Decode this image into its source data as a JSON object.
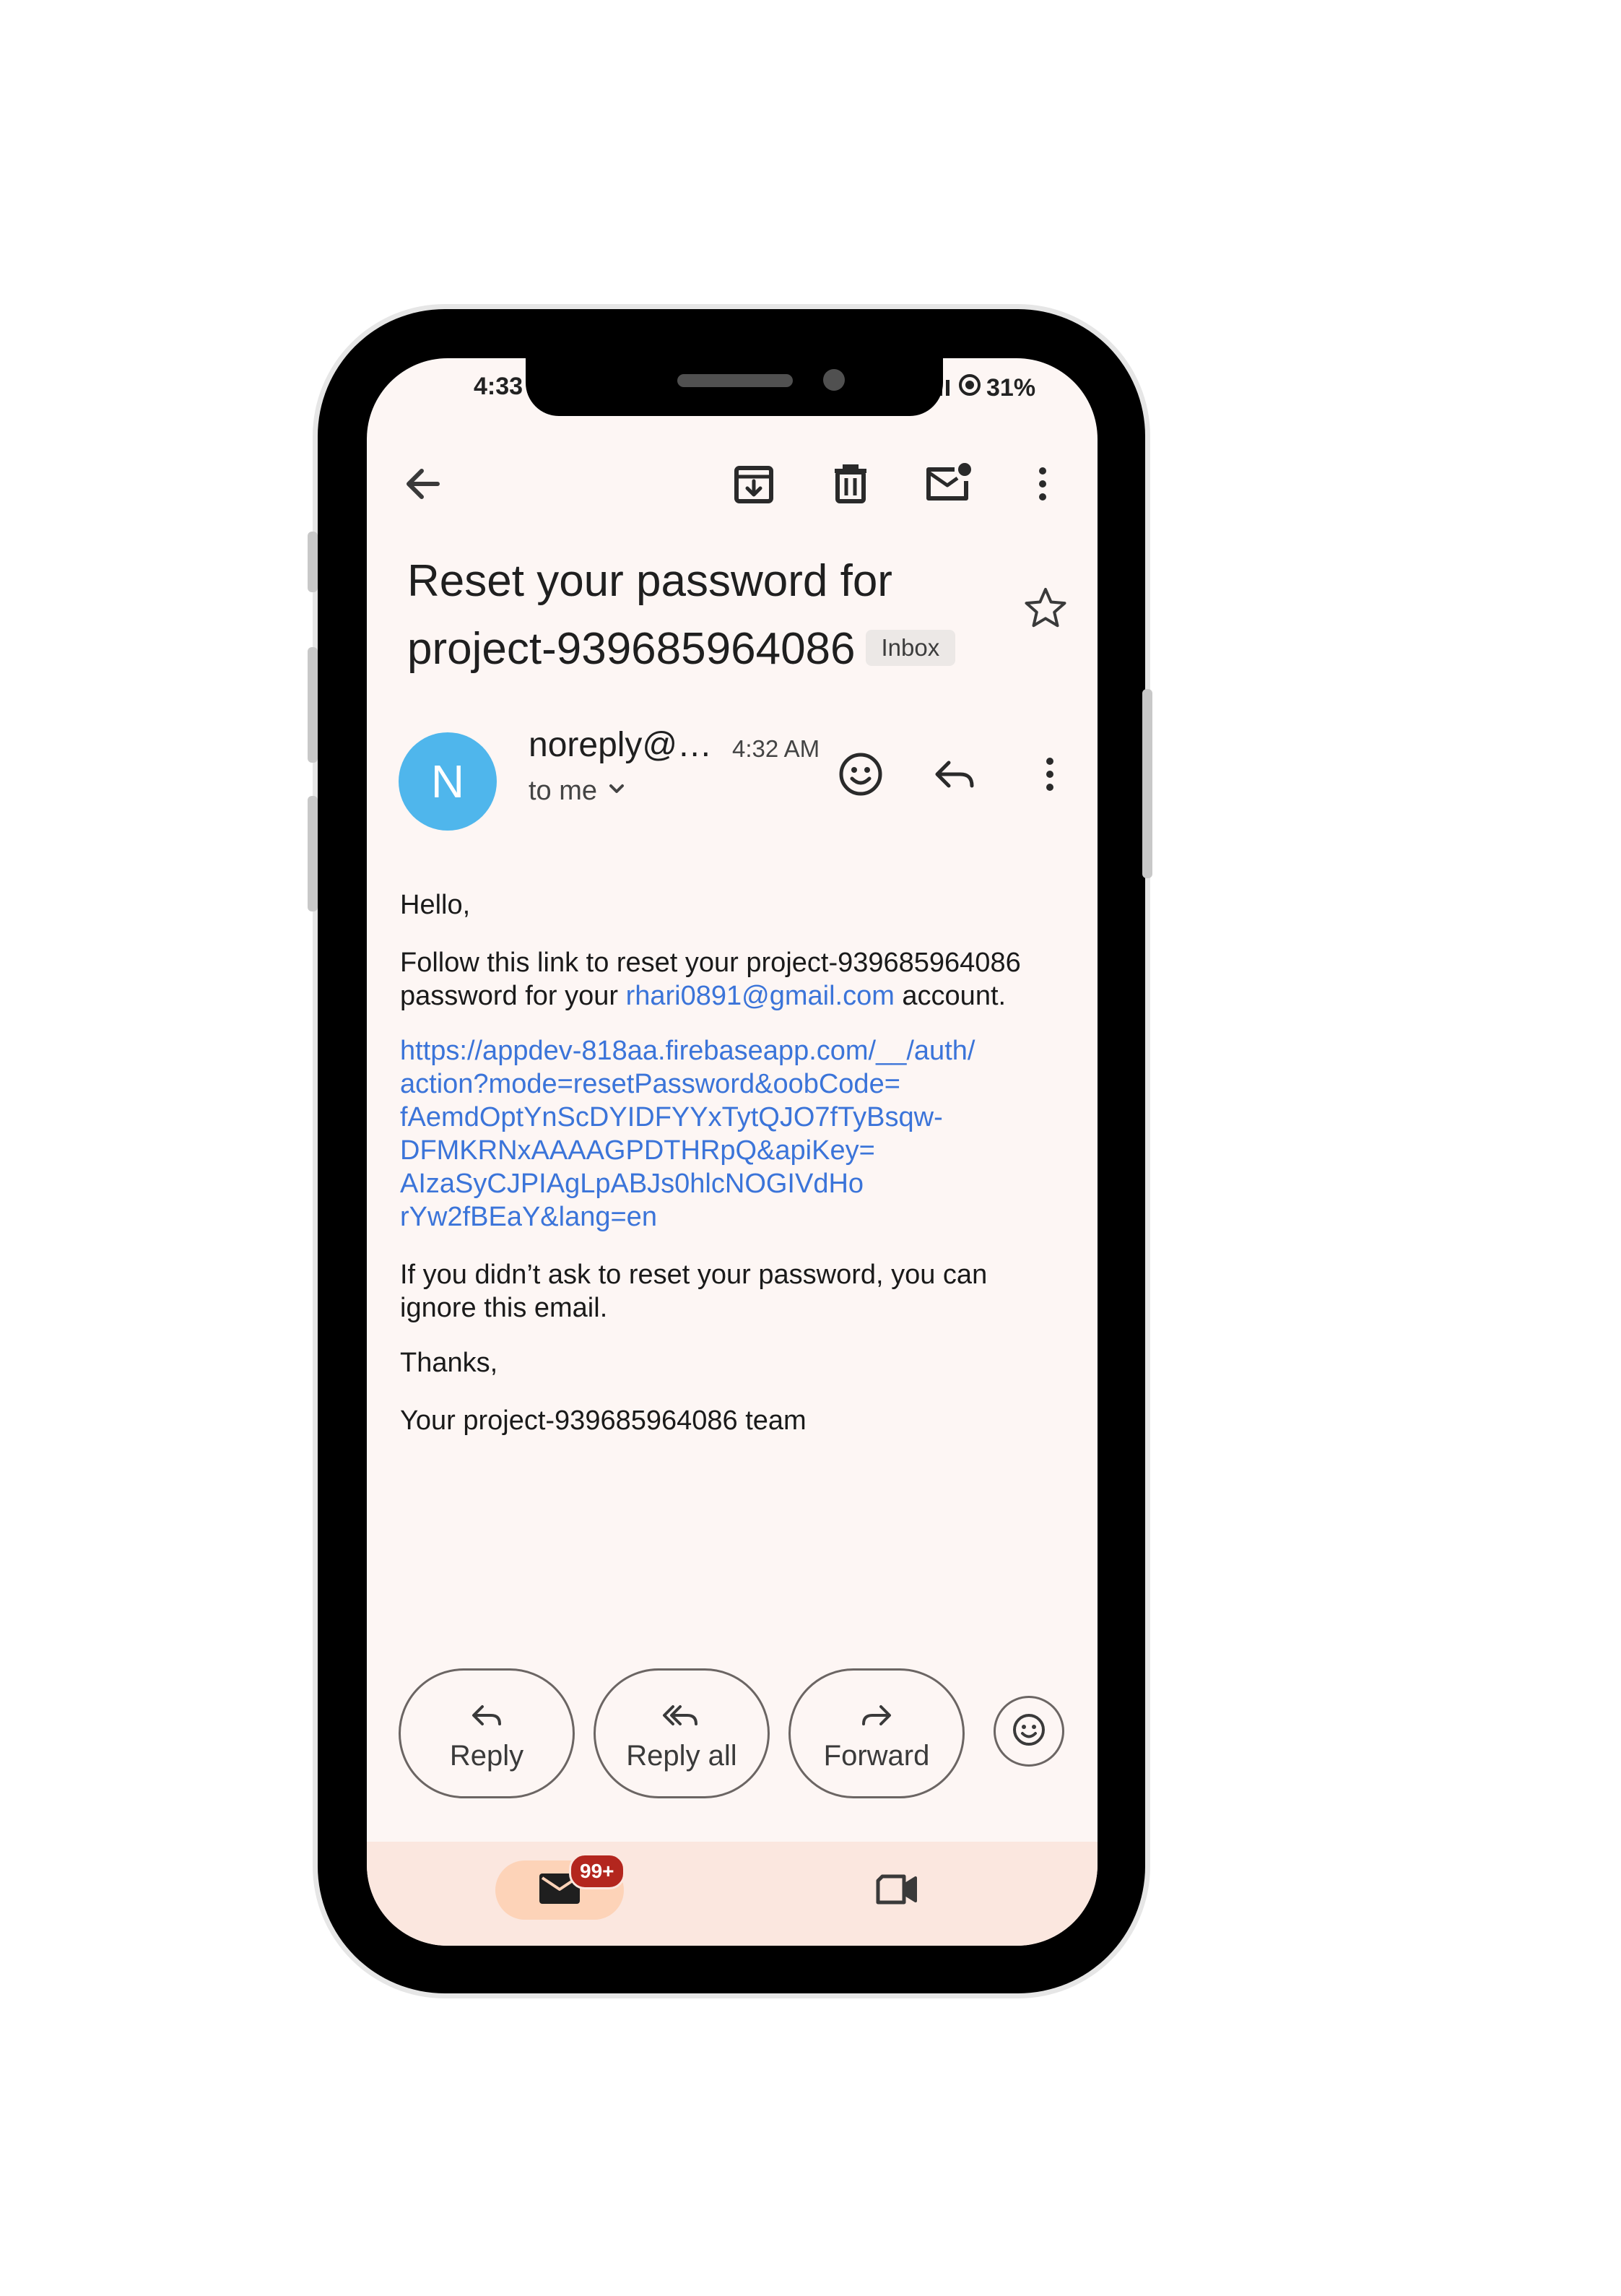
{
  "status_bar": {
    "time": "4:33",
    "battery": "31%"
  },
  "toolbar": {
    "back_icon": "arrow-left-icon",
    "archive_icon": "archive-icon",
    "delete_icon": "trash-icon",
    "mark_unread_icon": "mail-unread-icon",
    "more_icon": "more-vert-icon"
  },
  "email": {
    "subject_line1": "Reset your password for",
    "subject_line2": "project-939685964086",
    "label": "Inbox",
    "sender_initial": "N",
    "sender": "noreply@…",
    "time": "4:32 AM",
    "recipient": "to me",
    "greeting": "Hello,",
    "para1_a": "Follow this link to reset your project-939685964086",
    "para1_b": "password for your ",
    "para1_email": "rhari0891@gmail.com",
    "para1_c": " account.",
    "link_lines": [
      "https://appdev-818aa.firebaseapp.com/__/auth/",
      "action?mode=resetPassword&oobCode=",
      "fAemdOptYnScDYIDFYYxTytQJO7fTyBsqw-",
      "DFMKRNxAAAAGPDTHRpQ&apiKey=",
      "AIzaSyCJPIAgLpABJs0hlcNOGIVdHo",
      "rYw2fBEaY&lang=en"
    ],
    "para2_a": "If you didn’t ask to reset your password, you can",
    "para2_b": "ignore this email.",
    "thanks": "Thanks,",
    "signature": "Your project-939685964086 team"
  },
  "actions": {
    "reply": "Reply",
    "reply_all": "Reply all",
    "forward": "Forward"
  },
  "bottom_nav": {
    "mail_badge": "99+",
    "mail_icon": "mail-icon",
    "meet_icon": "video-icon"
  },
  "colors": {
    "avatar": "#4fb6ec",
    "link": "#3b74d9",
    "badge": "#b3261e",
    "screen_bg": "#fdf6f4"
  }
}
